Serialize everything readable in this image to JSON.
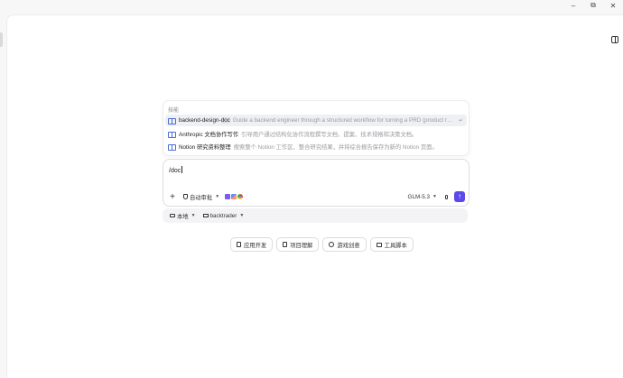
{
  "window_controls": {
    "minimize": "–",
    "maximize": "⧉",
    "close": "✕"
  },
  "skills": {
    "header": "技能",
    "items": [
      {
        "name_prefix": "backend-design-",
        "name_match": "doc",
        "description": "Guide a backend engineer through a structured workflow for turning a PRD (product requirement) re...",
        "active": true
      },
      {
        "name_prefix": "Anthropic 文档协作写作",
        "name_match": "",
        "description": "引导用户通过结构化协作流程撰写文档、提案、技术规格和决策文档。",
        "active": false
      },
      {
        "name_prefix": "Notion 研究资料整理",
        "name_match": "",
        "description": "搜索整个 Notion 工作区、整合研究结果，并将综合报告保存为新的 Notion 页面。",
        "active": false
      }
    ],
    "enter_hint": "↵"
  },
  "composer": {
    "input_value": "/doc",
    "plus_label": "+",
    "approval_label": "自动审批",
    "model_label": "GLM-5.3",
    "send_label": "↑"
  },
  "context": {
    "location_label": "本地",
    "folder_label": "backtrader"
  },
  "suggestions": [
    {
      "label": "应用开发",
      "icon": "phone-icon"
    },
    {
      "label": "项目理解",
      "icon": "document-icon"
    },
    {
      "label": "游戏创意",
      "icon": "gamepad-icon"
    },
    {
      "label": "工具脚本",
      "icon": "terminal-icon"
    }
  ],
  "colors": {
    "accent": "#5b4ae8",
    "skill_icon": "#4b6bd6"
  }
}
